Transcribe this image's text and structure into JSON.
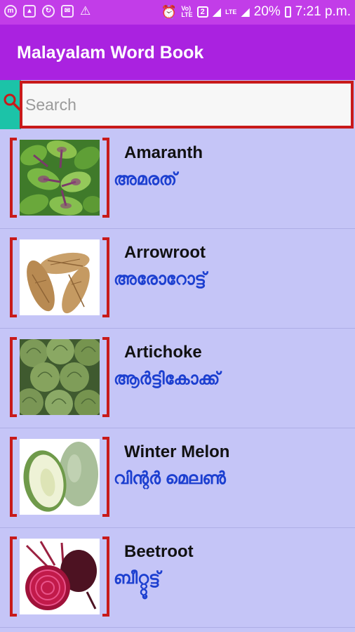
{
  "status_bar": {
    "battery": "20%",
    "time": "7:21 p.m.",
    "volte": "Vo)\nLTE",
    "sim": "2",
    "lte": "LTE"
  },
  "app_bar": {
    "title": "Malayalam Word Book"
  },
  "search": {
    "placeholder": "Search",
    "value": ""
  },
  "colors": {
    "status_bar": "#c23de8",
    "app_bar": "#aa22e0",
    "background": "#c5c5f7",
    "frame_red": "#c81a1a",
    "malayalam_text": "#1c3fd0",
    "teal": "#1cc3a8"
  },
  "words": [
    {
      "english": "Amaranth",
      "malayalam": "അമരത്",
      "image": "amaranth-leaves"
    },
    {
      "english": "Arrowroot",
      "malayalam": "അരോറോട്ട്",
      "image": "arrowroot-tubers"
    },
    {
      "english": "Artichoke",
      "malayalam": "ആർട്ടികോക്ക്",
      "image": "artichokes"
    },
    {
      "english": "Winter Melon",
      "malayalam": "വിന്റർ മെലൺ",
      "image": "winter-melon"
    },
    {
      "english": "Beetroot",
      "malayalam": "ബീറ്റ്റൂട്ട്",
      "image": "beetroot"
    }
  ]
}
